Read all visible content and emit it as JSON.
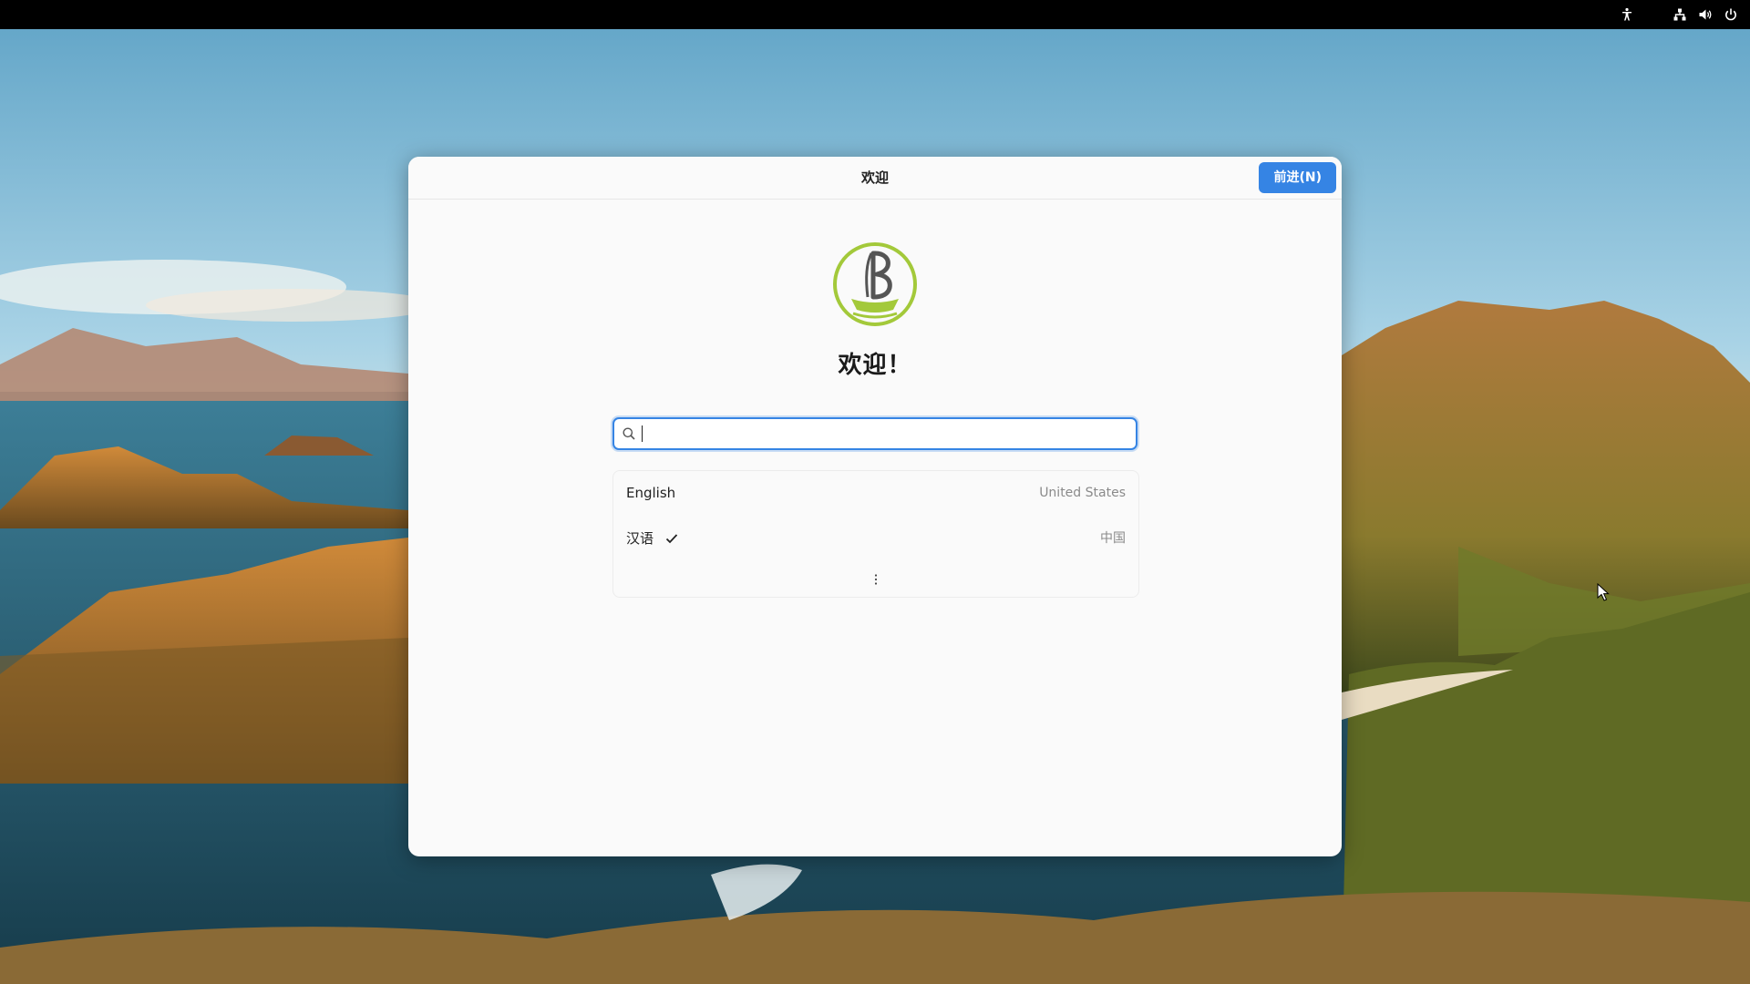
{
  "topbar": {
    "icons": [
      "accessibility-icon",
      "network-icon",
      "volume-icon",
      "power-icon"
    ]
  },
  "dialog": {
    "title": "欢迎",
    "next_label": "前进(N)",
    "heading": "欢迎！",
    "search": {
      "value": "",
      "placeholder": ""
    },
    "languages": [
      {
        "name": "English",
        "region": "United States",
        "selected": false
      },
      {
        "name": "汉语",
        "region": "中国",
        "selected": true
      }
    ],
    "more_icon": "more-vertical-icon"
  },
  "colors": {
    "accent": "#3584e4",
    "logo": "#a3c93a",
    "topbar": "#000000"
  }
}
